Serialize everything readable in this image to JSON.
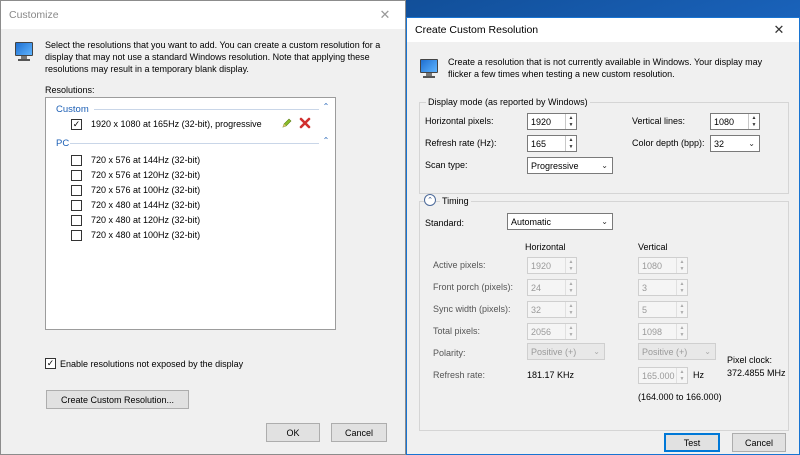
{
  "customize": {
    "title": "Customize",
    "intro": "Select the resolutions that you want to add. You can create a custom resolution for a display that may not use a standard Windows resolution. Note that applying these resolutions may result in a temporary blank display.",
    "resolutions_label": "Resolutions:",
    "groups": [
      {
        "name": "Custom",
        "items": [
          {
            "label": "1920 x 1080 at 165Hz (32-bit), progressive",
            "checked": true
          }
        ]
      },
      {
        "name": "PC",
        "items": [
          {
            "label": "720 x 576 at 144Hz (32-bit)",
            "checked": false
          },
          {
            "label": "720 x 576 at 120Hz (32-bit)",
            "checked": false
          },
          {
            "label": "720 x 576 at 100Hz (32-bit)",
            "checked": false
          },
          {
            "label": "720 x 480 at 144Hz (32-bit)",
            "checked": false
          },
          {
            "label": "720 x 480 at 120Hz (32-bit)",
            "checked": false
          },
          {
            "label": "720 x 480 at 100Hz (32-bit)",
            "checked": false
          }
        ]
      }
    ],
    "enable_label": "Enable resolutions not exposed by the display",
    "enable_checked": true,
    "create_button": "Create Custom Resolution...",
    "ok_button": "OK",
    "cancel_button": "Cancel",
    "check_glyph": "✓",
    "group_chevron": "⌃"
  },
  "create": {
    "title": "Create Custom Resolution",
    "intro": "Create a resolution that is not currently available in Windows. Your display may flicker a few times when testing a new custom resolution.",
    "display_mode_label": "Display mode (as reported by Windows)",
    "horizontal_pixels_label": "Horizontal pixels:",
    "horizontal_pixels_value": "1920",
    "vertical_lines_label": "Vertical lines:",
    "vertical_lines_value": "1080",
    "refresh_rate_label": "Refresh rate (Hz):",
    "refresh_rate_value": "165",
    "color_depth_label": "Color depth (bpp):",
    "color_depth_value": "32",
    "scan_type_label": "Scan type:",
    "scan_type_value": "Progressive",
    "timing_label": "Timing",
    "standard_label": "Standard:",
    "standard_value": "Automatic",
    "col_horizontal": "Horizontal",
    "col_vertical": "Vertical",
    "rows": [
      {
        "label": "Active pixels:",
        "h": "1920",
        "v": "1080"
      },
      {
        "label": "Front porch (pixels):",
        "h": "24",
        "v": "3"
      },
      {
        "label": "Sync width (pixels):",
        "h": "32",
        "v": "5"
      },
      {
        "label": "Total pixels:",
        "h": "2056",
        "v": "1098"
      }
    ],
    "polarity_label": "Polarity:",
    "polarity_h": "Positive (+)",
    "polarity_v": "Positive (+)",
    "pixel_clock_label": "Pixel clock:",
    "pixel_clock_value": "372.4855 MHz",
    "refresh_rate_row_label": "Refresh rate:",
    "refresh_rate_h": "181.17 KHz",
    "refresh_rate_v": "165.000",
    "refresh_unit": "Hz",
    "refresh_range": "(164.000 to 166.000)",
    "test_button": "Test",
    "cancel_button": "Cancel",
    "timing_glyph": "⌃"
  },
  "colors": {
    "accent": "#0078d7",
    "group_header": "#1c5fb5",
    "delete": "#d0302f",
    "edit": "#8bbf2b"
  }
}
